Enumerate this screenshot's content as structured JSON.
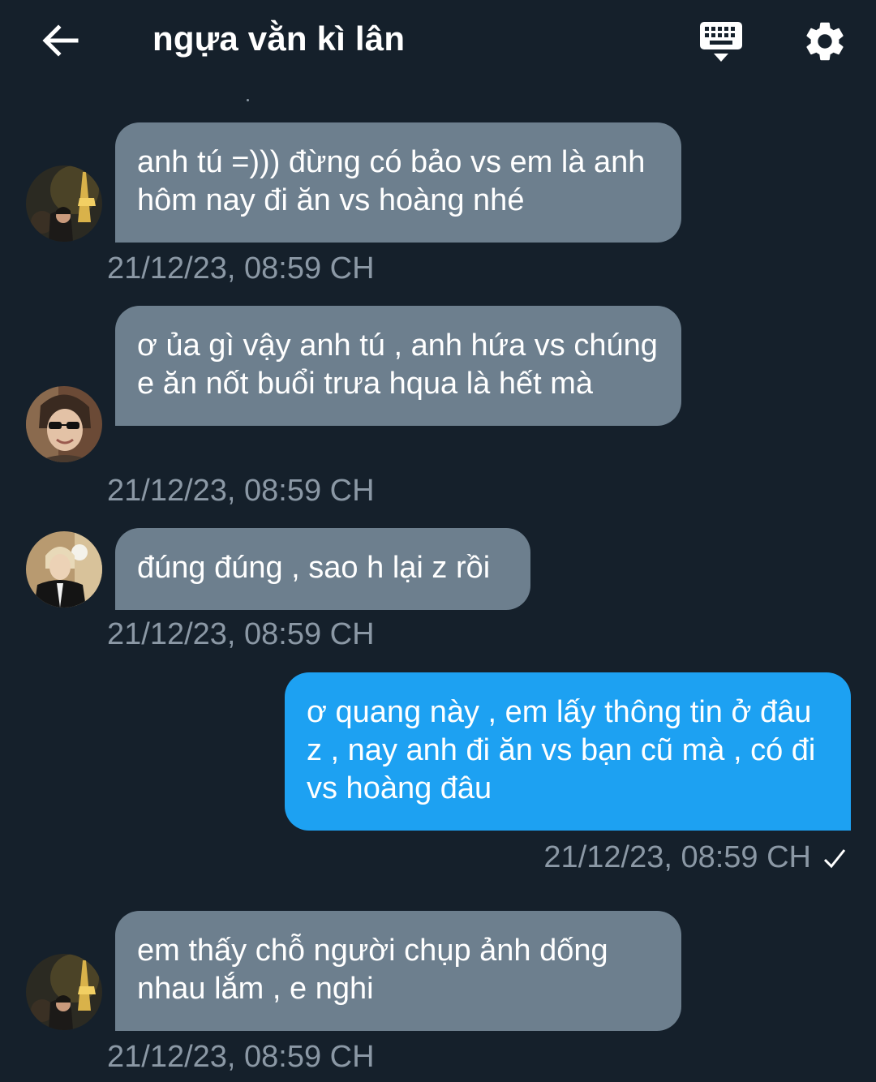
{
  "header": {
    "title": "ngựa vằn kì lân",
    "back_icon": "arrow-left-icon",
    "keyboard_icon": "keyboard-icon",
    "settings_icon": "gear-icon"
  },
  "colors": {
    "background": "#15202b",
    "incoming_bubble": "#6d7f8e",
    "outgoing_bubble": "#1da1f2",
    "timestamp": "#8b98a5"
  },
  "messages": [
    {
      "direction": "incoming",
      "text": "anh tú =))) đừng có bảo vs em là anh hôm nay đi ăn vs hoàng nhé",
      "timestamp": "21/12/23, 08:59 CH"
    },
    {
      "direction": "incoming",
      "text": "ơ ủa gì vậy anh tú , anh hứa vs chúng e ăn nốt buổi trưa hqua là hết mà",
      "timestamp": "21/12/23, 08:59 CH"
    },
    {
      "direction": "incoming",
      "text": "đúng đúng , sao h lại z rồi",
      "timestamp": "21/12/23, 08:59 CH"
    },
    {
      "direction": "outgoing",
      "text": "ơ quang này , em lấy thông tin ở đâu z , nay anh đi ăn vs bạn cũ mà , có đi vs hoàng đâu",
      "timestamp": "21/12/23, 08:59 CH",
      "status_icon": "checkmark-icon"
    },
    {
      "direction": "incoming",
      "text": "em thấy chỗ người chụp ảnh dống nhau lắm , e nghi",
      "timestamp": "21/12/23, 08:59 CH"
    }
  ]
}
